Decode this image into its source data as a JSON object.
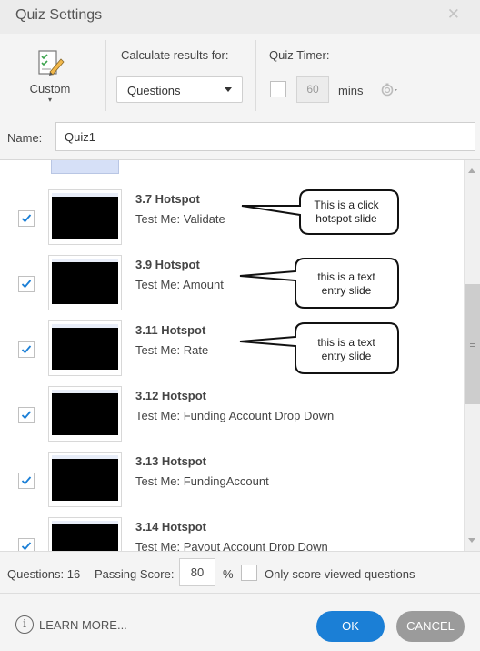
{
  "window": {
    "title": "Quiz Settings",
    "close_glyph": "✕"
  },
  "toolbar": {
    "custom": {
      "label": "Custom",
      "icon": "pencil-document-icon",
      "chevron": "▾"
    },
    "calculate_label": "Calculate results for:",
    "calculate_selected": "Questions",
    "timer_label": "Quiz Timer:",
    "timer_checked": false,
    "timer_value": "60",
    "timer_unit": "mins",
    "timer_icon": "stopwatch-icon"
  },
  "name_row": {
    "label": "Name:",
    "value": "Quiz1"
  },
  "slides": [
    {
      "title": "3.7 Hotspot",
      "subtitle": "Test Me: Validate",
      "checked": true
    },
    {
      "title": "3.9 Hotspot",
      "subtitle": "Test Me: Amount",
      "checked": true
    },
    {
      "title": "3.11 Hotspot",
      "subtitle": "Test Me: Rate",
      "checked": true
    },
    {
      "title": "3.12 Hotspot",
      "subtitle": "Test Me: Funding Account Drop Down",
      "checked": true
    },
    {
      "title": "3.13 Hotspot",
      "subtitle": "Test Me: FundingAccount",
      "checked": true
    },
    {
      "title": "3.14 Hotspot",
      "subtitle": "Test Me: Payout Account Drop Down",
      "checked": true
    }
  ],
  "callouts": [
    {
      "line1": "This is a click",
      "line2": "hotspot slide"
    },
    {
      "line1": "this is a text",
      "line2": "entry slide"
    },
    {
      "line1": "this is a text",
      "line2": "entry slide"
    }
  ],
  "stats": {
    "questions_label": "Questions: 16",
    "passing_label": "Passing Score:",
    "passing_value": "80",
    "passing_unit": "%",
    "only_viewed_label": "Only score viewed questions",
    "only_viewed_checked": false
  },
  "footer": {
    "info_glyph": "i",
    "learn_more": "LEARN MORE...",
    "ok": "OK",
    "cancel": "CANCEL"
  },
  "colors": {
    "accent": "#1b7fd6",
    "cancel": "#9b9b9b",
    "check": "#1b7fd6"
  }
}
